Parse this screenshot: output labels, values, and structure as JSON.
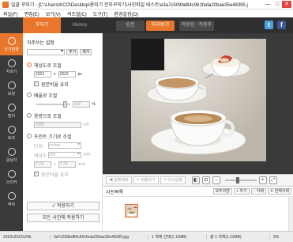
{
  "window": {
    "title": "일괄 꾸미기 - [C:\\Users\\KCO\\Desktop\\용미기 전부꾸미기\\사진파일 테스트\\e3a7c509bd84c961feda20bae35e48395.jpg]",
    "controls": [
      "—",
      "□",
      "✕"
    ]
  },
  "menu": [
    "파일(F)",
    "편집(E)",
    "보기(V)",
    "색조절(C)",
    "도구(T)",
    "환경설정(O)"
  ],
  "left_tools": [
    {
      "label": "크기변경",
      "icon": "resize-icon",
      "active": true
    },
    {
      "label": "자르기",
      "icon": "crop-icon",
      "active": false
    },
    {
      "label": "보정",
      "icon": "adjust-icon",
      "active": false
    },
    {
      "label": "필터",
      "icon": "filter-icon",
      "active": false
    },
    {
      "label": "효과",
      "icon": "effect-icon",
      "active": false
    },
    {
      "label": "글상자",
      "icon": "text-icon",
      "active": false
    },
    {
      "label": "스티커",
      "icon": "sticker-icon",
      "active": false
    },
    {
      "label": "액자",
      "icon": "frame-icon",
      "active": false
    }
  ],
  "panel_tabs": {
    "work": "꾸미기",
    "history": "History"
  },
  "view_tabs": {
    "original": "원본",
    "preview": "미리보기",
    "after": "적용된 : 적용후"
  },
  "social": [
    "t",
    "f"
  ],
  "panel": {
    "frequent_size": "자주쓰는 설정",
    "add": "추가",
    "delete": "제거",
    "pixel_label": "해상도로 조절",
    "width": "2322",
    "height": "2322",
    "times": "x",
    "px_unit": "px",
    "keep_ratio": "원본비율 유지",
    "percent_label": "배율로 조절",
    "percent_value": "100",
    "percent_unit": "%",
    "capacity_label": "용량으로 조절",
    "capacity_value": "5000",
    "capacity_unit": "KB",
    "print_label": "프린트 크기로 조절",
    "unit_label": "단위",
    "unit_value": "inches",
    "resolution_label": "해상도",
    "resolution_value": "300",
    "dpi": "DPI",
    "print_w": "7.74",
    "print_h": "7.74",
    "print_unit": "inch",
    "print_keep": "원본비율 유지",
    "apply_button": "✓ 적용하기",
    "apply_all_button": "모든 사진에 적용하기"
  },
  "toolbar": {
    "prev": "◀ 원래대로",
    "undo": "↶ 되돌리기",
    "redo": "↷ 다시실행",
    "zoom_minus": "−",
    "zoom_plus": "+"
  },
  "photolist": {
    "title": "사진목록",
    "buttons": [
      "모두저장",
      "+ 추가",
      "− 삭제",
      "✕ 전체삭제"
    ]
  },
  "status": {
    "size": "2322x2322x24b",
    "filename": "3a7c509bd84c961feda20bae35e48395.jpg",
    "selected": "1 개체 선택(1.11MB)",
    "total": "총 1 개체(1.11MB)",
    "zoom": "5%"
  },
  "colors": {
    "accent": "#e8762b",
    "dark": "#3a3a3a"
  }
}
